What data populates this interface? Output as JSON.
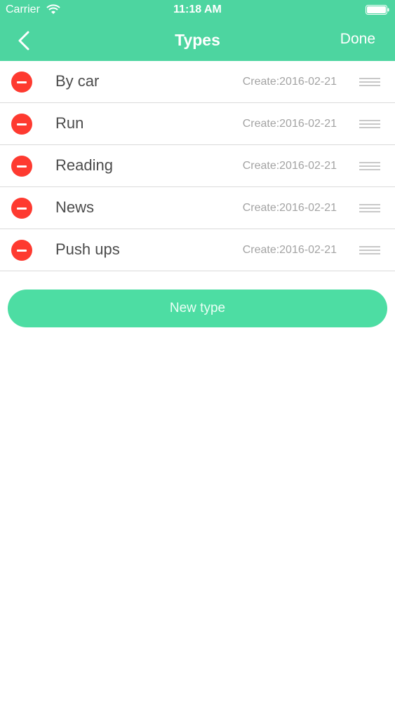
{
  "status_bar": {
    "carrier": "Carrier",
    "time": "11:18 AM",
    "wifi_icon": "wifi-icon",
    "battery_icon": "battery-icon"
  },
  "navbar": {
    "title": "Types",
    "back_icon": "chevron-left-icon",
    "done_label": "Done"
  },
  "types": [
    {
      "name": "By car",
      "created": "Create:2016-02-21"
    },
    {
      "name": "Run",
      "created": "Create:2016-02-21"
    },
    {
      "name": "Reading",
      "created": "Create:2016-02-21"
    },
    {
      "name": "News",
      "created": "Create:2016-02-21"
    },
    {
      "name": "Push ups",
      "created": "Create:2016-02-21"
    }
  ],
  "actions": {
    "new_type_label": "New type"
  },
  "colors": {
    "header": "#4dd5a0",
    "button": "#4ddda3",
    "delete": "#fe3a30"
  }
}
